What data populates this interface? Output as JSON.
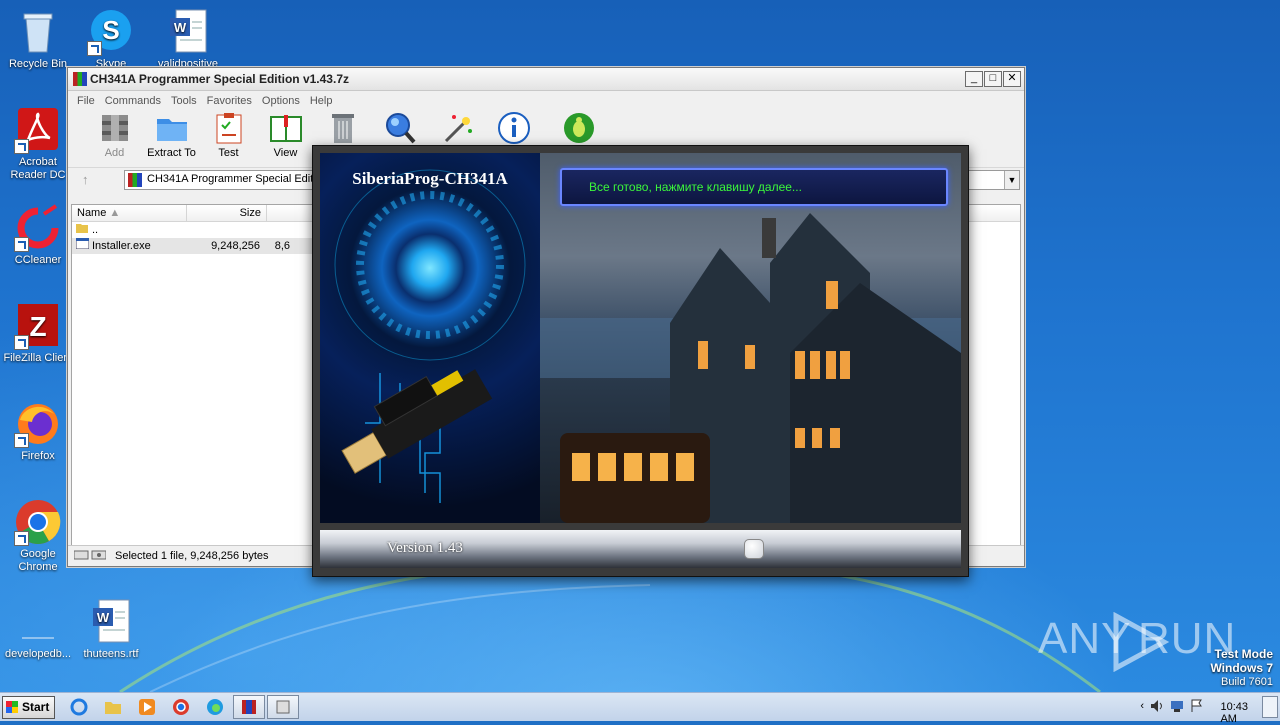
{
  "desktop": {
    "icons": [
      {
        "label": "Recycle Bin"
      },
      {
        "label": "Skype"
      },
      {
        "label": "validpositive"
      },
      {
        "label": "Acrobat Reader DC"
      },
      {
        "label": "CCleaner"
      },
      {
        "label": "FileZilla Client"
      },
      {
        "label": "Firefox"
      },
      {
        "label": "Google Chrome"
      },
      {
        "label": "developedb..."
      },
      {
        "label": "thuteens.rtf"
      }
    ]
  },
  "window": {
    "title": "CH341A Programmer Special Edition v1.43.7z",
    "menu": [
      "File",
      "Commands",
      "Tools",
      "Favorites",
      "Options",
      "Help"
    ],
    "toolbar": [
      {
        "label": "Add",
        "icon": "add-archive-icon"
      },
      {
        "label": "Extract To",
        "icon": "extract-folder-icon"
      },
      {
        "label": "Test",
        "icon": "test-clipboard-icon"
      },
      {
        "label": "View",
        "icon": "view-book-icon"
      }
    ],
    "address": "CH341A Programmer Special Edition",
    "columns": {
      "name": "Name",
      "size": "Size"
    },
    "rows": [
      {
        "name": "..",
        "size": "",
        "packed": ""
      },
      {
        "name": "Installer.exe",
        "size": "9,248,256",
        "packed": "8,6"
      }
    ],
    "status": "Selected 1 file, 9,248,256 bytes"
  },
  "installer": {
    "title": "SiberiaProg-CH341A",
    "message": "Все готово, нажмите клавишу далее...",
    "version": "Version 1.43",
    "accent": "#3bf63b"
  },
  "watermark": {
    "brand_left": "ANY",
    "brand_right": "RUN"
  },
  "testmode": {
    "line1": "Test Mode",
    "line2": "Windows 7",
    "line3": "Build 7601"
  },
  "taskbar": {
    "start": "Start",
    "clock": "10:43 AM"
  }
}
